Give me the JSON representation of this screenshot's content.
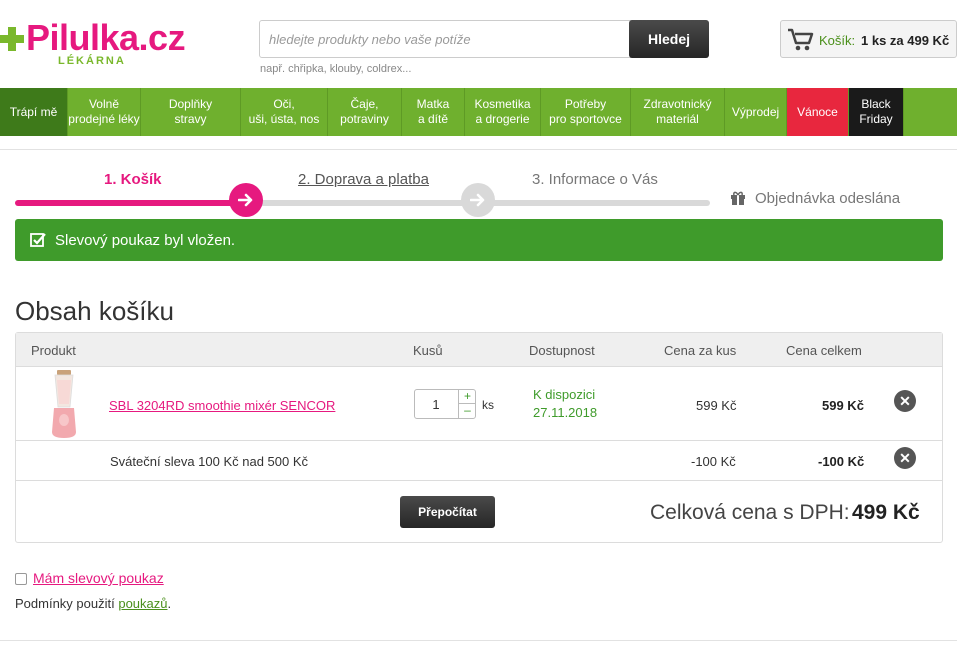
{
  "header": {
    "brand": "Pilulka.cz",
    "brand_sub": "LÉKÁRNA",
    "search_placeholder": "hledejte produkty nebo vaše potíže",
    "search_button": "Hledej",
    "search_hint": "např. chřipka, klouby, coldrex...",
    "cart_label": "Košík:",
    "cart_value": "1 ks za 499 Kč"
  },
  "nav": [
    {
      "label": "Trápí mě",
      "style": "first"
    },
    {
      "label": "Volně\nprodejné léky",
      "style": ""
    },
    {
      "label": "Doplňky\nstravy",
      "style": ""
    },
    {
      "label": "Oči,\nuši, ústa, nos",
      "style": ""
    },
    {
      "label": "Čaje,\npotraviny",
      "style": ""
    },
    {
      "label": "Matka\na dítě",
      "style": ""
    },
    {
      "label": "Kosmetika\na drogerie",
      "style": ""
    },
    {
      "label": "Potřeby\npro sportovce",
      "style": ""
    },
    {
      "label": "Zdravotnický\nmateriál",
      "style": ""
    },
    {
      "label": "Výprodej",
      "style": ""
    },
    {
      "label": "Vánoce",
      "style": "red"
    },
    {
      "label": "Black\nFriday",
      "style": "black"
    }
  ],
  "steps": {
    "step1": "1. Košík",
    "step2": "2. Doprava a platba",
    "step3": "3. Informace o Vás",
    "step4": "Objednávka odeslána"
  },
  "alert": "Slevový poukaz byl vložen.",
  "cart_title": "Obsah košíku",
  "table": {
    "headers": {
      "product": "Produkt",
      "qty": "Kusů",
      "availability": "Dostupnost",
      "unit_price": "Cena za kus",
      "total": "Cena celkem"
    },
    "item": {
      "name": "SBL 3204RD smoothie mixér SENCOR",
      "qty": "1",
      "qty_unit": "ks",
      "availability_line1": "K dispozici",
      "availability_line2": "27.11.2018",
      "unit_price": "599 Kč",
      "total": "599 Kč"
    },
    "discount": {
      "name": "Sváteční sleva 100 Kč nad 500 Kč",
      "unit_price": "-100 Kč",
      "total": "-100 Kč"
    },
    "recalc_button": "Přepočítat",
    "total_label": "Celková cena s DPH:",
    "total_value": "499 Kč"
  },
  "voucher_link": "Mám slevový poukaz",
  "conditions_text": "Podmínky použití",
  "conditions_link": "poukazů",
  "colors": {
    "brand_pink": "#e6197f",
    "brand_green": "#6fb02e",
    "success": "#3f9b2b"
  }
}
